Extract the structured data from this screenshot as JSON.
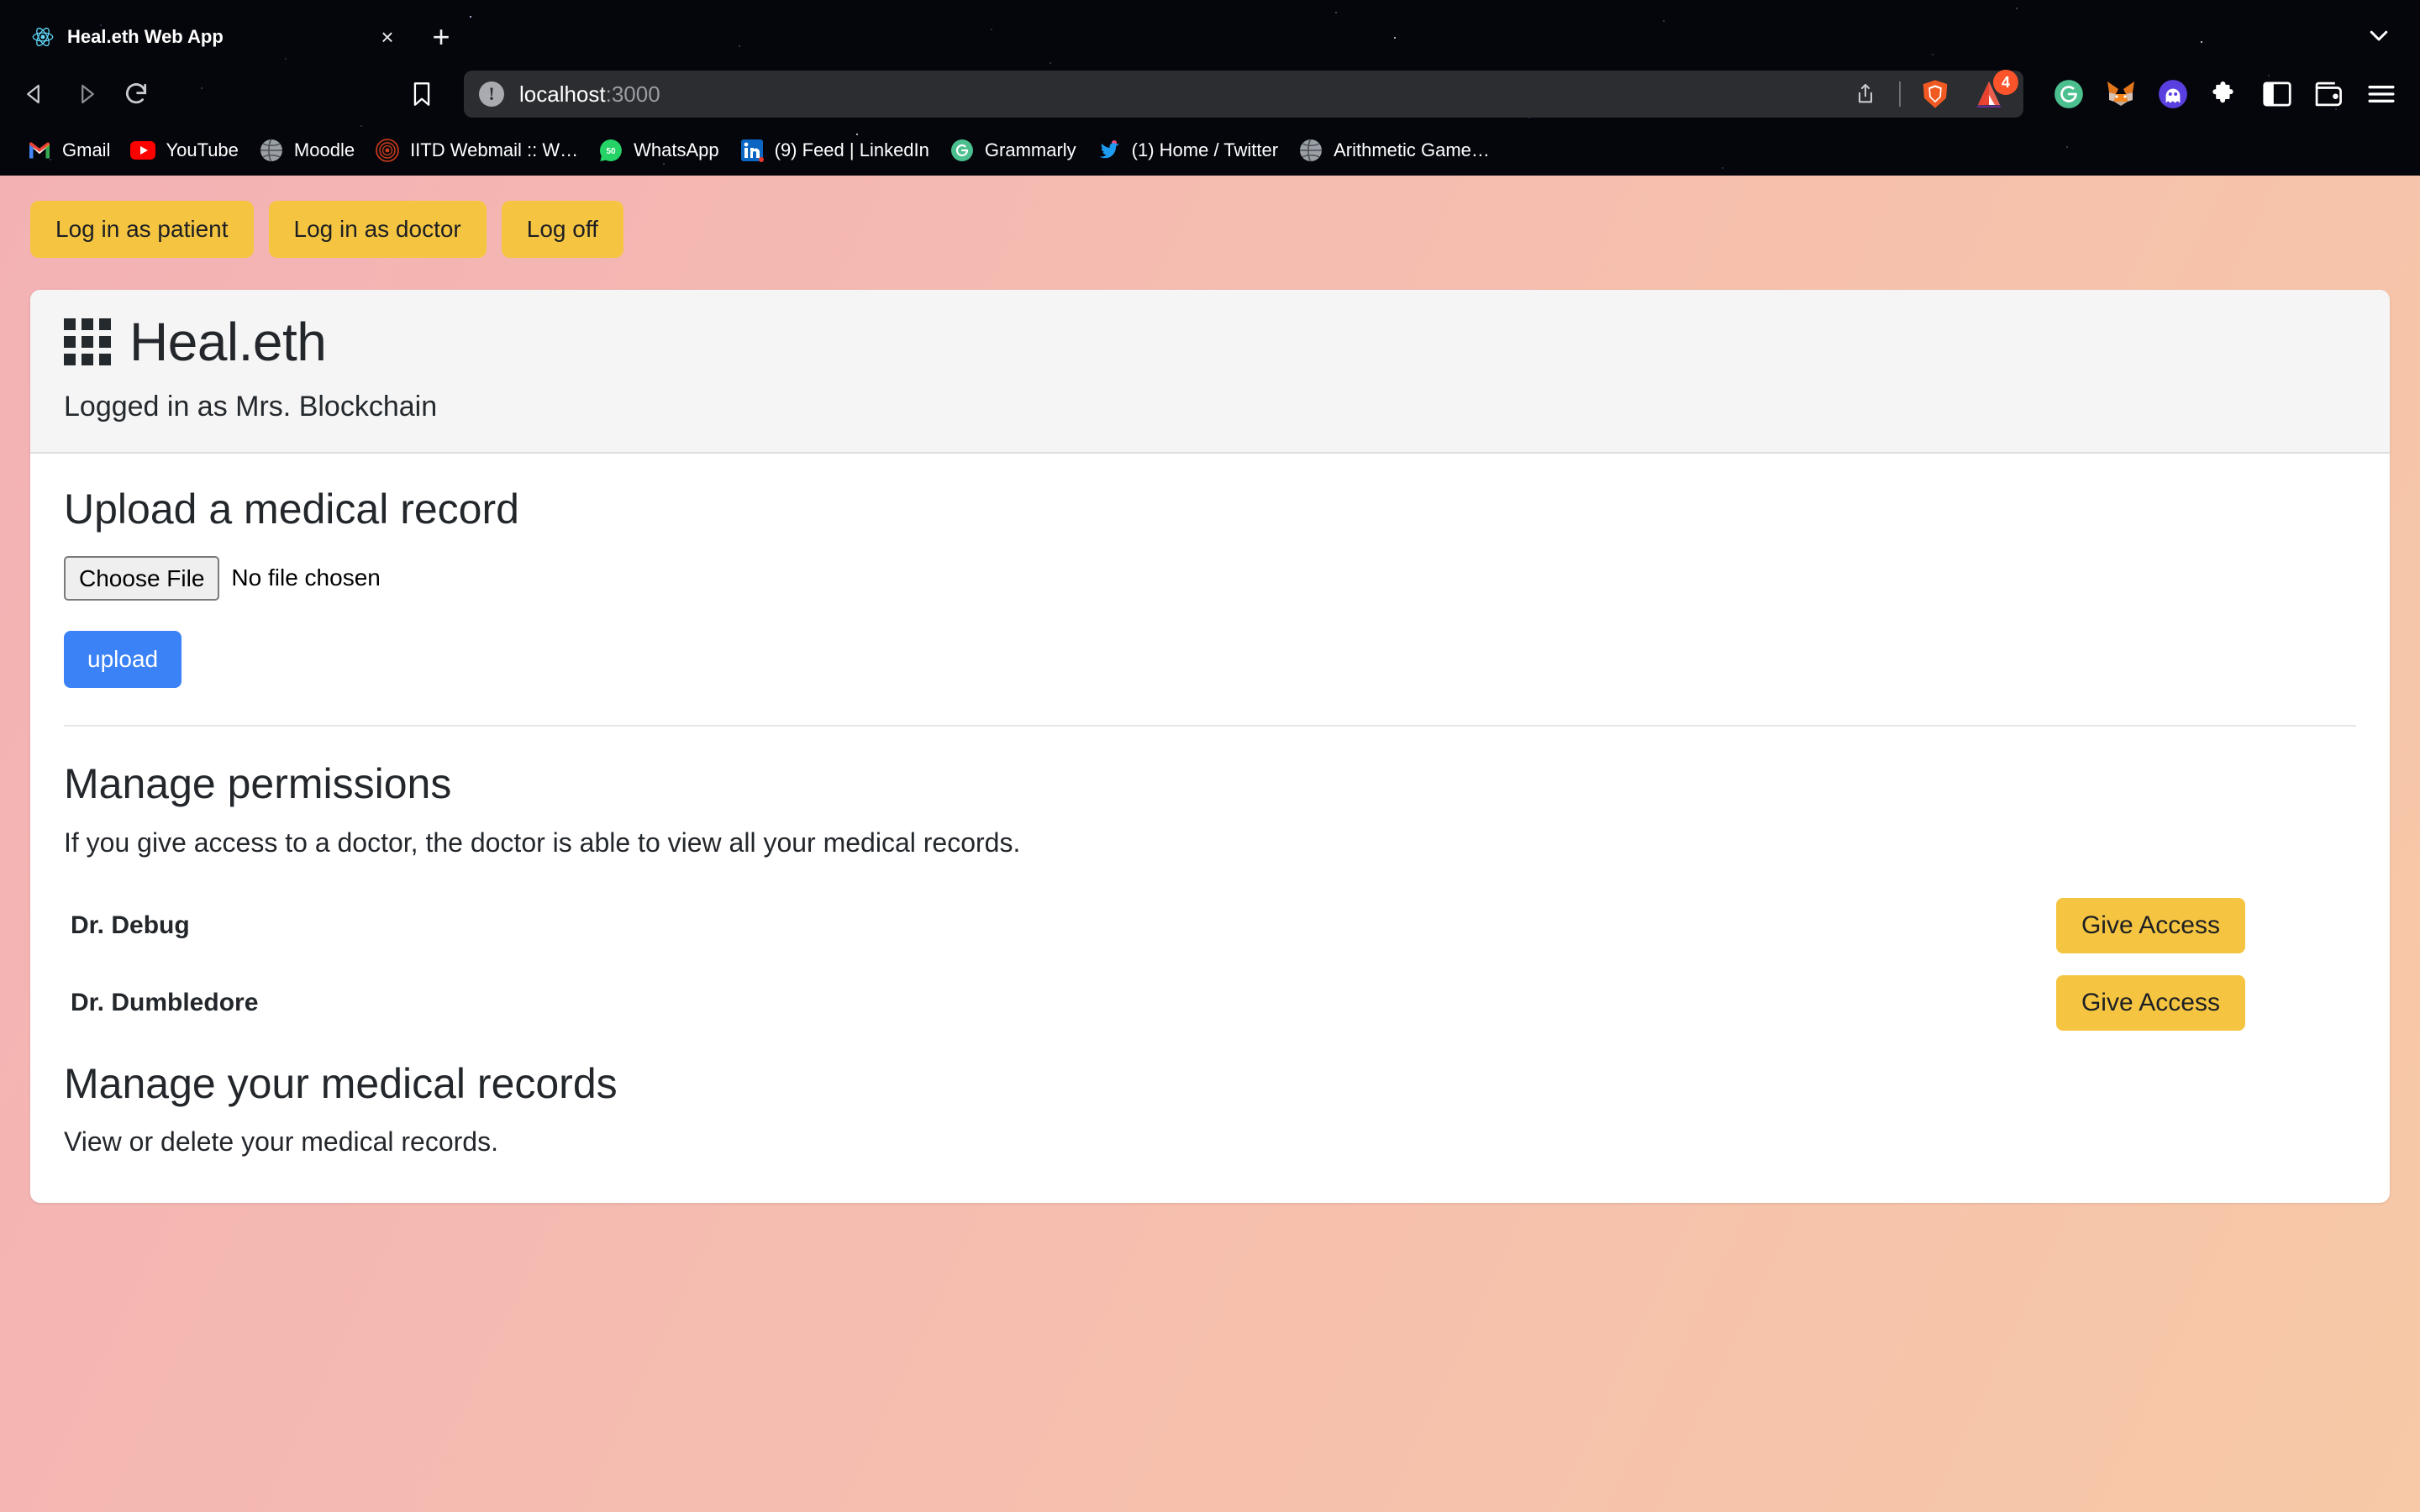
{
  "browser": {
    "tab": {
      "title": "Heal.eth Web App",
      "favicon": "react-logo-icon",
      "close_label": "×"
    },
    "new_tab_label": "+",
    "tabstrip_chevron": "chevron-down-icon",
    "nav": {
      "back": "back-arrow-icon",
      "forward": "forward-arrow-icon",
      "reload": "reload-icon",
      "bookmark": "bookmark-icon"
    },
    "url": {
      "host": "localhost",
      "port": ":3000",
      "info_icon": "not-secure-info-icon",
      "share_icon": "share-icon",
      "shield_icon": "brave-shield-icon",
      "rewards_icon": "brave-rewards-bat-icon",
      "rewards_badge": "4"
    },
    "extensions": [
      {
        "name": "grammarly-extension-icon",
        "label": "G"
      },
      {
        "name": "metamask-extension-icon",
        "label": ""
      },
      {
        "name": "ghost-extension-icon",
        "label": ""
      },
      {
        "name": "puzzle-extensions-icon",
        "label": ""
      },
      {
        "name": "sidebar-toggle-icon",
        "label": ""
      },
      {
        "name": "brave-wallet-icon",
        "label": ""
      },
      {
        "name": "browser-menu-icon",
        "label": ""
      }
    ],
    "bookmarks": [
      {
        "label": "Gmail",
        "icon": "gmail-icon"
      },
      {
        "label": "YouTube",
        "icon": "youtube-icon"
      },
      {
        "label": "Moodle",
        "icon": "globe-icon"
      },
      {
        "label": "IITD Webmail :: W…",
        "icon": "webmail-icon"
      },
      {
        "label": "WhatsApp",
        "icon": "whatsapp-icon"
      },
      {
        "label": "(9) Feed | LinkedIn",
        "icon": "linkedin-icon"
      },
      {
        "label": "Grammarly",
        "icon": "grammarly-icon"
      },
      {
        "label": "(1) Home / Twitter",
        "icon": "twitter-icon"
      },
      {
        "label": "Arithmetic Game…",
        "icon": "globe-icon"
      }
    ]
  },
  "page": {
    "auth_buttons": [
      {
        "label": "Log in as patient"
      },
      {
        "label": "Log in as doctor"
      },
      {
        "label": "Log off"
      }
    ],
    "header": {
      "brand": "Heal.eth",
      "logo_icon": "grid-logo-icon",
      "logged_in": "Logged in as Mrs. Blockchain"
    },
    "upload": {
      "title": "Upload a medical record",
      "choose_file_label": "Choose File",
      "file_status": "No file chosen",
      "upload_label": "upload"
    },
    "permissions": {
      "title": "Manage permissions",
      "description": "If you give access to a doctor, the doctor is able to view all your medical records.",
      "doctors": [
        {
          "name": "Dr. Debug",
          "action": "Give Access"
        },
        {
          "name": "Dr. Dumbledore",
          "action": "Give Access"
        }
      ]
    },
    "records": {
      "title": "Manage your medical records",
      "description": "View or delete your medical records."
    },
    "colors": {
      "accent_yellow": "#f5c542",
      "upload_blue": "#3b82f6",
      "bg_gradient_start": "#f3b1b4",
      "bg_gradient_end": "#f7c9a6",
      "card_header": "#f5f5f5"
    }
  }
}
